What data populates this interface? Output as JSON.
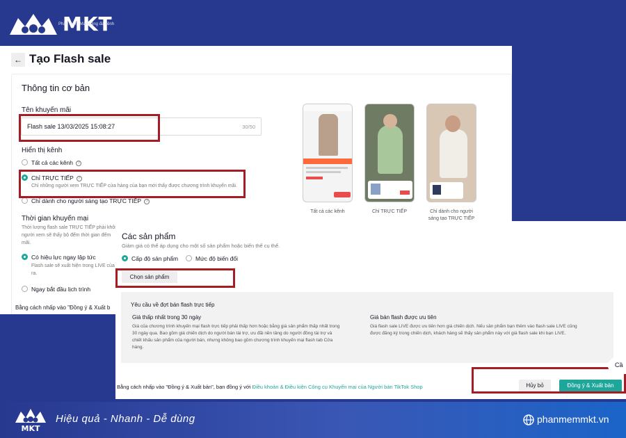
{
  "brand": {
    "name": "MKT",
    "tagline": "Phần mềm Marketing đa kênh"
  },
  "page": {
    "title": "Tạo Flash sale",
    "back_icon": "←"
  },
  "basic_info": {
    "section_title": "Thông tin cơ bản",
    "promo_name_label": "Tên khuyến mãi",
    "promo_name_value": "Flash sale 13/03/2025 15:08:27",
    "promo_name_count": "30/50",
    "channel_label": "Hiển thị kênh",
    "channel_options": [
      {
        "label": "Tất cả các kênh",
        "selected": false
      },
      {
        "label": "Chỉ TRỰC TIẾP",
        "selected": true,
        "hint": "Chỉ những người xem TRỰC TIẾP cửa hàng của bạn mới thấy được chương trình khuyến mãi."
      },
      {
        "label": "Chỉ dành cho người sáng tạo TRỰC TIẾP",
        "selected": false
      }
    ],
    "time_label": "Thời gian khuyến mại",
    "time_hint_1": "Thời lượng flash sale TRỰC TIẾP phải khôn",
    "time_hint_2": "người xem sẽ thấy bộ đếm thời gian đếm",
    "time_hint_3": "mãi.",
    "time_options": [
      {
        "label": "Có hiệu lực ngay lập tức",
        "selected": true,
        "hint_1": "Flash sale sẽ xuất hiện trong LIVE của",
        "hint_2": "ra."
      },
      {
        "label": "Ngay bắt đầu lịch trình",
        "selected": false
      }
    ],
    "agree_note": "Bằng cách nhấp vào \"Đồng ý & Xuất b"
  },
  "previews": [
    {
      "caption": "Tất cả các kênh"
    },
    {
      "caption": "Chỉ TRỰC TIẾP"
    },
    {
      "caption": "Chỉ dành cho người",
      "caption_2": "sáng tạo TRỰC TIẾP"
    }
  ],
  "products": {
    "title": "Các sản phẩm",
    "subtitle": "Giảm giá có thể áp dụng cho một số sản phẩm hoặc biến thể cụ thể.",
    "level_options": [
      {
        "label": "Cấp độ sản phẩm",
        "selected": true
      },
      {
        "label": "Mức độ biến đổi",
        "selected": false
      }
    ],
    "choose_button": "Chọn sản phẩm",
    "requirements": {
      "title": "Yêu cầu về đợt bán flash trực tiếp",
      "col1_title": "Giá thấp nhất trong 30 ngày",
      "col1_lines": [
        "Giá của chương trình khuyến mại flash trực tiếp phải thấp hơn hoặc bằng giá sản phẩm thấp nhất trong",
        "30 ngày qua. Bao gồm giá chiến dịch do người bán tài trợ, ưu đãi nền tảng do người đồng tài trợ và",
        "chiết khấu sản phẩm của người bán, nhưng không bao gồm chương trình khuyến mại flash tab Cửa",
        "hàng."
      ],
      "col2_title": "Giá bán flash được ưu tiên",
      "col2_lines": [
        "Giá flash sale LIVE được ưu tiên hơn giá chiến dịch. Nếu sản phẩm bạn thêm vào flash sale LIVE cũng",
        "được đăng ký trong chiến dịch, khách hàng sẽ thấy sản phẩm này với giá flash sale khi bạn LIVE."
      ]
    },
    "footer_prefix": "Bằng cách nhấp vào \"Đồng ý & Xuất bản\", bạn đồng ý với ",
    "footer_link": "Điều khoản & Điều kiện Công cụ Khuyến mại của Người bán TikTok Shop",
    "cancel_button": "Hủy bỏ",
    "publish_button": "Đồng ý & Xuất bản",
    "side_bubble": "Cầ"
  },
  "footer_band": {
    "logo_text": "MKT",
    "slogan": "Hiệu quả - Nhanh  - Dễ dùng",
    "website": "phanmemmkt.vn"
  },
  "colors": {
    "background": "#27388f",
    "accent": "#1fa69a",
    "highlight": "#a51c24"
  }
}
